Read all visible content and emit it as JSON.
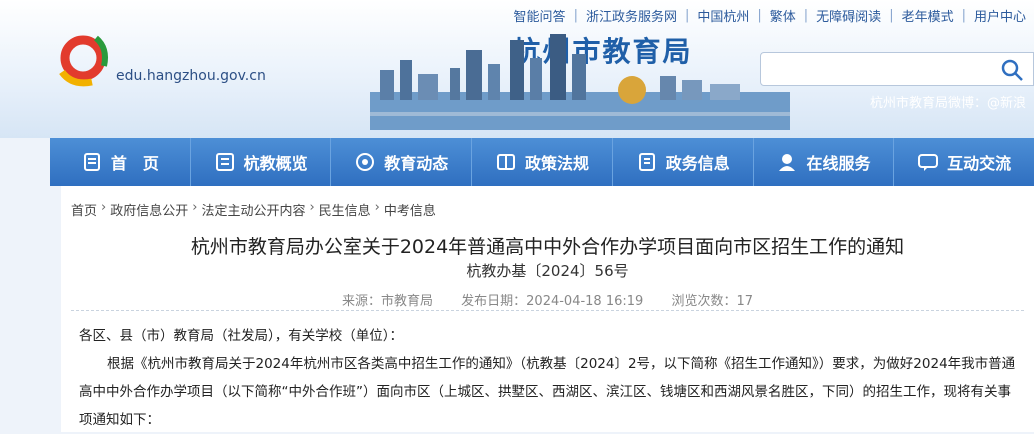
{
  "toplinks": [
    "智能问答",
    "浙江政务服务网",
    "中国杭州",
    "繁体",
    "无障碍阅读",
    "老年模式",
    "用户中心"
  ],
  "logo": {
    "title": "杭州市教育局",
    "domain": "edu.hangzhou.gov.cn"
  },
  "weibo": "杭州市教育局微博：@新浪",
  "nav": [
    {
      "label": "首　页",
      "icon": "home-icon"
    },
    {
      "label": "杭教概览",
      "icon": "overview-icon"
    },
    {
      "label": "教育动态",
      "icon": "news-icon"
    },
    {
      "label": "政策法规",
      "icon": "policy-icon"
    },
    {
      "label": "政务信息",
      "icon": "info-icon"
    },
    {
      "label": "在线服务",
      "icon": "service-icon"
    },
    {
      "label": "互动交流",
      "icon": "chat-icon"
    }
  ],
  "breadcrumb": [
    "首页",
    "政府信息公开",
    "法定主动公开内容",
    "民生信息",
    "中考信息"
  ],
  "article": {
    "title": "杭州市教育局办公室关于2024年普通高中中外合作办学项目面向市区招生工作的通知",
    "doc_no": "杭教办基〔2024〕56号",
    "source": "来源：市教育局",
    "date": "发布日期：2024-04-18 16:19",
    "views": "浏览次数：17",
    "salutation": "各区、县（市）教育局（社发局），有关学校（单位）：",
    "para1": "根据《杭州市教育局关于2024年杭州市区各类高中招生工作的通知》（杭教基〔2024〕2号，以下简称《招生工作通知》）要求，为做好2024年我市普通高中中外合作办学项目（以下简称“中外合作班”）面向市区（上城区、拱墅区、西湖区、滨江区、钱塘区和西湖风景名胜区，下同）的招生工作，现将有关事项通知如下："
  },
  "colors": {
    "nav": "#2f6fc0",
    "brand": "#1f5fa8"
  }
}
